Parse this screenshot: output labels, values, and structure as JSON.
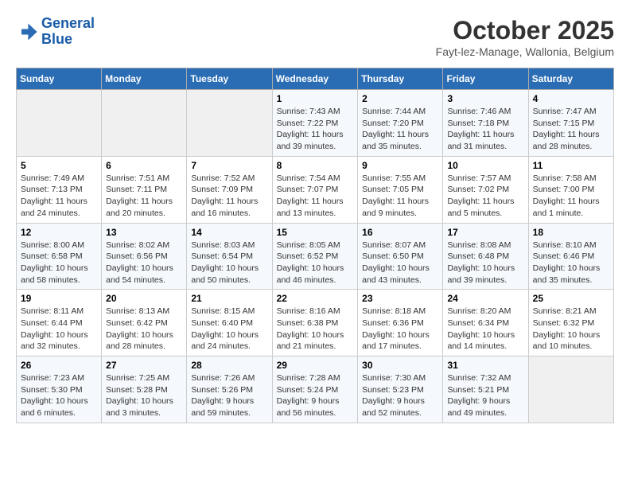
{
  "header": {
    "logo_line1": "General",
    "logo_line2": "Blue",
    "month": "October 2025",
    "location": "Fayt-lez-Manage, Wallonia, Belgium"
  },
  "days_of_week": [
    "Sunday",
    "Monday",
    "Tuesday",
    "Wednesday",
    "Thursday",
    "Friday",
    "Saturday"
  ],
  "weeks": [
    [
      {
        "day": "",
        "info": ""
      },
      {
        "day": "",
        "info": ""
      },
      {
        "day": "",
        "info": ""
      },
      {
        "day": "1",
        "info": "Sunrise: 7:43 AM\nSunset: 7:22 PM\nDaylight: 11 hours and 39 minutes."
      },
      {
        "day": "2",
        "info": "Sunrise: 7:44 AM\nSunset: 7:20 PM\nDaylight: 11 hours and 35 minutes."
      },
      {
        "day": "3",
        "info": "Sunrise: 7:46 AM\nSunset: 7:18 PM\nDaylight: 11 hours and 31 minutes."
      },
      {
        "day": "4",
        "info": "Sunrise: 7:47 AM\nSunset: 7:15 PM\nDaylight: 11 hours and 28 minutes."
      }
    ],
    [
      {
        "day": "5",
        "info": "Sunrise: 7:49 AM\nSunset: 7:13 PM\nDaylight: 11 hours and 24 minutes."
      },
      {
        "day": "6",
        "info": "Sunrise: 7:51 AM\nSunset: 7:11 PM\nDaylight: 11 hours and 20 minutes."
      },
      {
        "day": "7",
        "info": "Sunrise: 7:52 AM\nSunset: 7:09 PM\nDaylight: 11 hours and 16 minutes."
      },
      {
        "day": "8",
        "info": "Sunrise: 7:54 AM\nSunset: 7:07 PM\nDaylight: 11 hours and 13 minutes."
      },
      {
        "day": "9",
        "info": "Sunrise: 7:55 AM\nSunset: 7:05 PM\nDaylight: 11 hours and 9 minutes."
      },
      {
        "day": "10",
        "info": "Sunrise: 7:57 AM\nSunset: 7:02 PM\nDaylight: 11 hours and 5 minutes."
      },
      {
        "day": "11",
        "info": "Sunrise: 7:58 AM\nSunset: 7:00 PM\nDaylight: 11 hours and 1 minute."
      }
    ],
    [
      {
        "day": "12",
        "info": "Sunrise: 8:00 AM\nSunset: 6:58 PM\nDaylight: 10 hours and 58 minutes."
      },
      {
        "day": "13",
        "info": "Sunrise: 8:02 AM\nSunset: 6:56 PM\nDaylight: 10 hours and 54 minutes."
      },
      {
        "day": "14",
        "info": "Sunrise: 8:03 AM\nSunset: 6:54 PM\nDaylight: 10 hours and 50 minutes."
      },
      {
        "day": "15",
        "info": "Sunrise: 8:05 AM\nSunset: 6:52 PM\nDaylight: 10 hours and 46 minutes."
      },
      {
        "day": "16",
        "info": "Sunrise: 8:07 AM\nSunset: 6:50 PM\nDaylight: 10 hours and 43 minutes."
      },
      {
        "day": "17",
        "info": "Sunrise: 8:08 AM\nSunset: 6:48 PM\nDaylight: 10 hours and 39 minutes."
      },
      {
        "day": "18",
        "info": "Sunrise: 8:10 AM\nSunset: 6:46 PM\nDaylight: 10 hours and 35 minutes."
      }
    ],
    [
      {
        "day": "19",
        "info": "Sunrise: 8:11 AM\nSunset: 6:44 PM\nDaylight: 10 hours and 32 minutes."
      },
      {
        "day": "20",
        "info": "Sunrise: 8:13 AM\nSunset: 6:42 PM\nDaylight: 10 hours and 28 minutes."
      },
      {
        "day": "21",
        "info": "Sunrise: 8:15 AM\nSunset: 6:40 PM\nDaylight: 10 hours and 24 minutes."
      },
      {
        "day": "22",
        "info": "Sunrise: 8:16 AM\nSunset: 6:38 PM\nDaylight: 10 hours and 21 minutes."
      },
      {
        "day": "23",
        "info": "Sunrise: 8:18 AM\nSunset: 6:36 PM\nDaylight: 10 hours and 17 minutes."
      },
      {
        "day": "24",
        "info": "Sunrise: 8:20 AM\nSunset: 6:34 PM\nDaylight: 10 hours and 14 minutes."
      },
      {
        "day": "25",
        "info": "Sunrise: 8:21 AM\nSunset: 6:32 PM\nDaylight: 10 hours and 10 minutes."
      }
    ],
    [
      {
        "day": "26",
        "info": "Sunrise: 7:23 AM\nSunset: 5:30 PM\nDaylight: 10 hours and 6 minutes."
      },
      {
        "day": "27",
        "info": "Sunrise: 7:25 AM\nSunset: 5:28 PM\nDaylight: 10 hours and 3 minutes."
      },
      {
        "day": "28",
        "info": "Sunrise: 7:26 AM\nSunset: 5:26 PM\nDaylight: 9 hours and 59 minutes."
      },
      {
        "day": "29",
        "info": "Sunrise: 7:28 AM\nSunset: 5:24 PM\nDaylight: 9 hours and 56 minutes."
      },
      {
        "day": "30",
        "info": "Sunrise: 7:30 AM\nSunset: 5:23 PM\nDaylight: 9 hours and 52 minutes."
      },
      {
        "day": "31",
        "info": "Sunrise: 7:32 AM\nSunset: 5:21 PM\nDaylight: 9 hours and 49 minutes."
      },
      {
        "day": "",
        "info": ""
      }
    ]
  ]
}
